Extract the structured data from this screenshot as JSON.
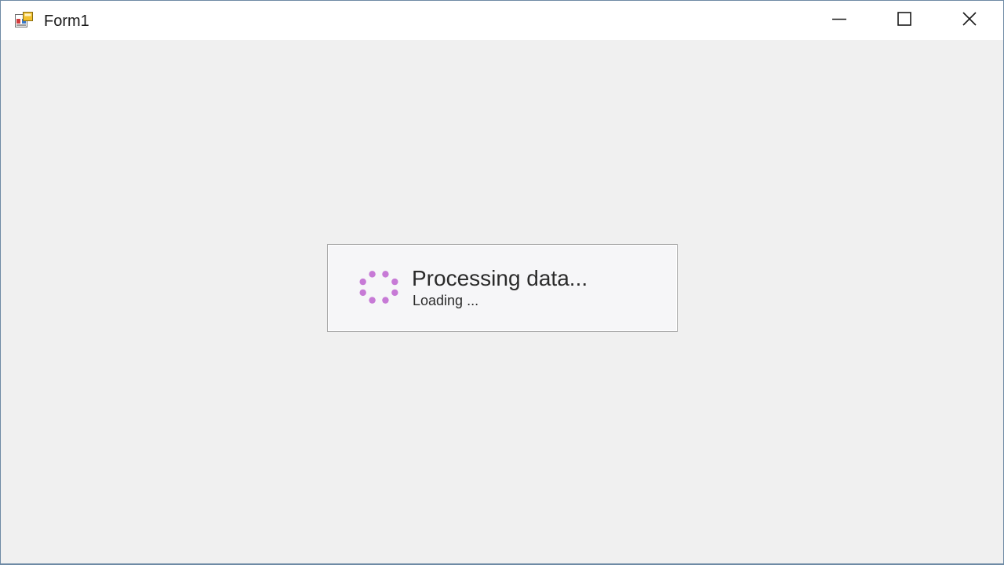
{
  "window": {
    "title": "Form1",
    "icon": "form-app-icon"
  },
  "title_controls": {
    "minimize_icon": "minimize-icon",
    "maximize_icon": "maximize-icon",
    "close_icon": "close-icon"
  },
  "wait_form": {
    "caption": "Processing data...",
    "description": "Loading ...",
    "spinner_icon": "loading-spinner-icon",
    "spinner_color": "#c77ad6"
  },
  "colors": {
    "client_background": "#f0f0f0",
    "titlebar_background": "#ffffff",
    "window_border": "#6e8aa5"
  }
}
